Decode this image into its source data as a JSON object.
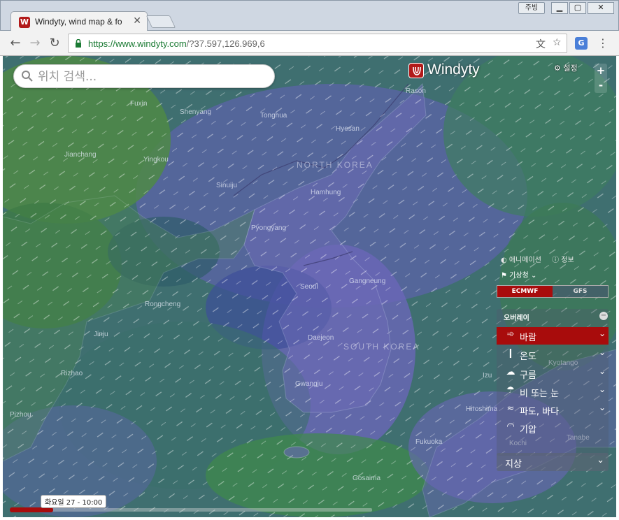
{
  "browser": {
    "tab_title": "Windyty, wind map & fo",
    "tab_favicon": "W",
    "user_button": "주빙",
    "url_scheme": "https://",
    "url_host": "www.windyty.com",
    "url_rest": "/?37.597,126.969,6"
  },
  "search": {
    "placeholder": "위치 검색..."
  },
  "logo": {
    "text": "Windyty"
  },
  "settings": {
    "label": "설정"
  },
  "zoom": {
    "in": "+",
    "out": "-"
  },
  "info": {
    "animation": "애니메이션",
    "info": "정보",
    "source": "기상청"
  },
  "models": [
    {
      "label": "ECMWF",
      "active": true
    },
    {
      "label": "GFS",
      "active": false
    }
  ],
  "overlay": {
    "header": "오버레이",
    "items": [
      {
        "label": "바람",
        "icon": "wind-icon",
        "glyph": "➾",
        "active": true,
        "chevron": true
      },
      {
        "label": "온도",
        "icon": "thermometer-icon",
        "glyph": "🌡",
        "active": false,
        "chevron": true
      },
      {
        "label": "구름",
        "icon": "cloud-icon",
        "glyph": "☁",
        "active": false,
        "chevron": true
      },
      {
        "label": "비 또는 눈",
        "icon": "rain-icon",
        "glyph": "⛆",
        "active": false,
        "chevron": true
      },
      {
        "label": "파도, 바다",
        "icon": "wave-icon",
        "glyph": "≈",
        "active": false,
        "chevron": true
      },
      {
        "label": "기압",
        "icon": "gauge-icon",
        "glyph": "◠",
        "active": false,
        "chevron": false
      }
    ]
  },
  "ground": {
    "label": "지상"
  },
  "timeline": {
    "current": "화요일 27 - 10:00",
    "progress": 0.12
  },
  "map_labels": {
    "north_korea": "NORTH KOREA",
    "south_korea": "SOUTH KOREA",
    "cities": [
      "Fuxin",
      "Shenyang",
      "Tonghua",
      "Hyesan",
      "Rason",
      "Jianchang",
      "Yingkou",
      "Sinuiju",
      "Hamhung",
      "Pyongyang",
      "Seoul",
      "Gangneung",
      "Rongcheng",
      "Daejeon",
      "Jinju",
      "Rizhao",
      "Gwangju",
      "Pizhou",
      "Hiroshima",
      "Kyotango",
      "Fukuoka",
      "Kochi",
      "Tanabe",
      "Gosaima",
      "Izu"
    ]
  }
}
